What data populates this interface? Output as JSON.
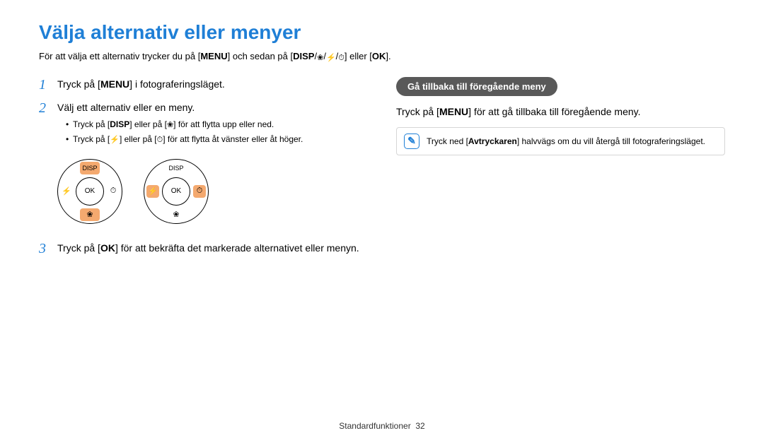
{
  "title": "Välja alternativ eller menyer",
  "intro": {
    "prefix": "För att välja ett alternativ trycker du på [",
    "menu": "MENU",
    "mid1": "] och sedan på [",
    "disp": "DISP",
    "slash": "/",
    "mid2": "] eller [",
    "ok": "OK",
    "suffix": "]."
  },
  "steps": {
    "s1": {
      "num": "1",
      "a": "Tryck på [",
      "menu": "MENU",
      "b": "] i fotograferingsläget."
    },
    "s2": {
      "num": "2",
      "main": "Välj ett alternativ eller en meny.",
      "b1a": "Tryck på [",
      "b1disp": "DISP",
      "b1b": "] eller på [",
      "b1c": "] för att flytta upp eller ned.",
      "b2a": "Tryck på [",
      "b2b": "] eller på [",
      "b2c": "] för att flytta åt vänster eller åt höger."
    },
    "s3": {
      "num": "3",
      "a": "Tryck på [",
      "ok": "OK",
      "b": "] för att bekräfta det markerade alternativet eller menyn."
    }
  },
  "wheel": {
    "disp": "DISP",
    "ok": "OK"
  },
  "right": {
    "pill": "Gå tillbaka till föregående meny",
    "text_a": "Tryck på [",
    "menu": "MENU",
    "text_b": "] för att gå tillbaka till föregående meny.",
    "note_a": "Tryck ned [",
    "note_bold": "Avtryckaren",
    "note_b": "] halvvägs om du vill återgå till fotograferingsläget."
  },
  "footer": {
    "section": "Standardfunktioner",
    "page": "32"
  }
}
